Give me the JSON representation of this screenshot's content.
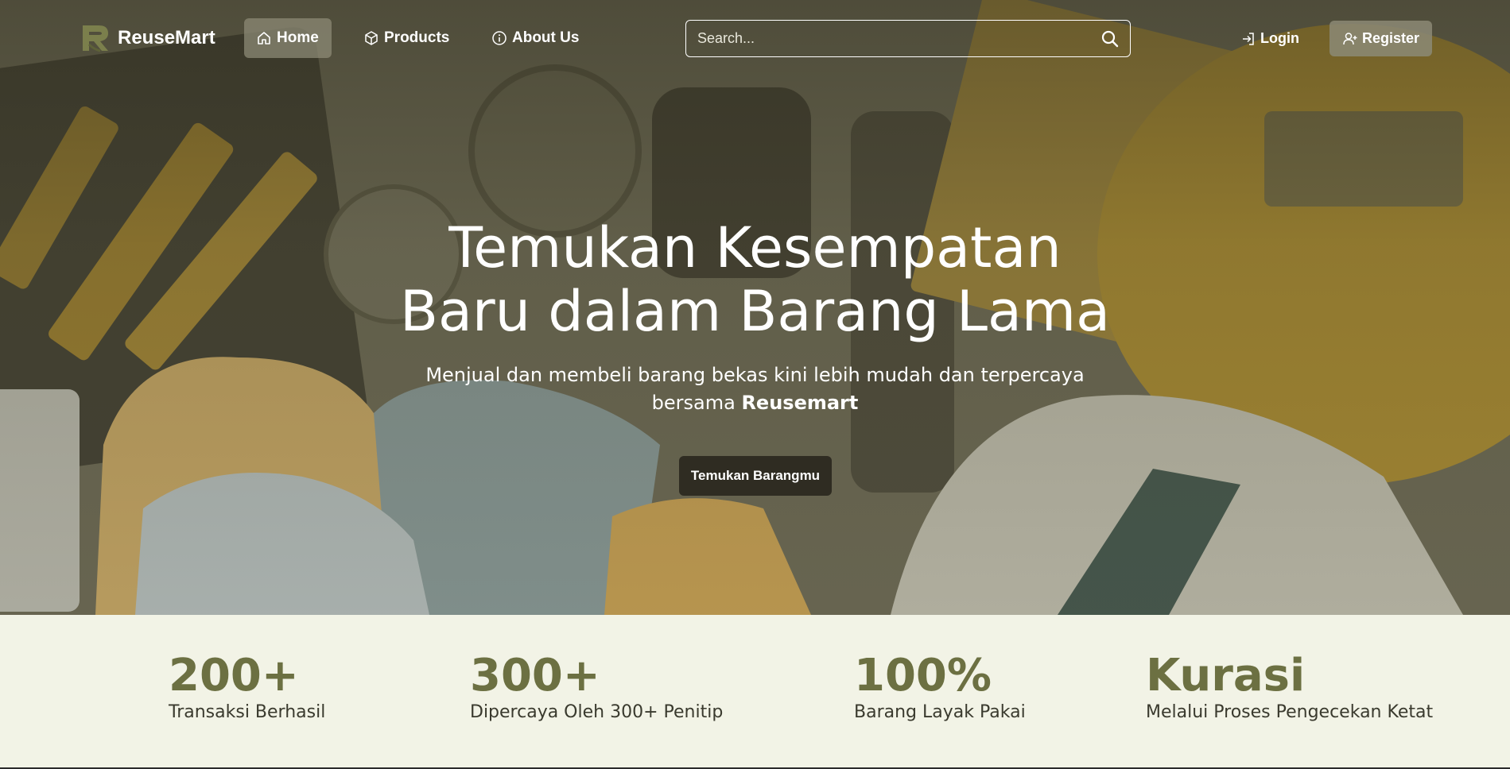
{
  "brand": {
    "name": "ReuseMart",
    "logo_icon": "recycle-r-logo-icon",
    "logo_color": "#7b7f4c"
  },
  "nav": {
    "items": [
      {
        "label": "Home",
        "icon": "home-icon",
        "active": true
      },
      {
        "label": "Products",
        "icon": "box-icon",
        "active": false
      },
      {
        "label": "About Us",
        "icon": "info-icon",
        "active": false
      }
    ],
    "search": {
      "placeholder": "Search...",
      "icon": "search-icon"
    },
    "login": {
      "label": "Login",
      "icon": "login-icon"
    },
    "register": {
      "label": "Register",
      "icon": "user-plus-icon"
    }
  },
  "hero": {
    "title_line1": "Temukan Kesempatan",
    "title_line2": "Baru dalam Barang Lama",
    "subtitle_line1": "Menjual dan membeli barang bekas kini lebih mudah dan terpercaya",
    "subtitle_prefix": "bersama ",
    "subtitle_brand": "Reusemart",
    "cta_label": "Temukan Barangmu"
  },
  "stats": [
    {
      "value": "200+",
      "label": "Transaksi Berhasil"
    },
    {
      "value": "300+",
      "label": "Dipercaya Oleh 300+ Penitip"
    },
    {
      "value": "100%",
      "label": "Barang Layak Pakai"
    },
    {
      "value": "Kurasi",
      "label": "Melalui Proses Pengecekan Ketat"
    }
  ],
  "colors": {
    "accent": "#6c7042",
    "stats_bg": "#f2f3e6",
    "cta_bg": "#2f2c22"
  }
}
